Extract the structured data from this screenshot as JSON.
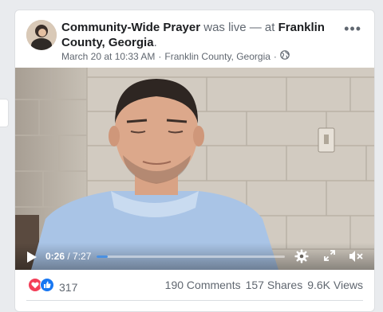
{
  "post": {
    "author": "Community-Wide Prayer",
    "action": " was live — at ",
    "location_bold": "Franklin County, Georgia",
    "trailing_dot": ".",
    "timestamp": "March 20 at 10:33 AM",
    "separator": " · ",
    "location": "Franklin County, Georgia",
    "separator2": " ·",
    "audience_icon": "globe-icon",
    "more_icon": "more-options-icon"
  },
  "video": {
    "current_time": "0:26",
    "total_time": " / 7:27",
    "progress": 0.058,
    "icons": [
      "play-icon",
      "settings-gear-icon",
      "fullscreen-icon",
      "muted-volume-icon"
    ]
  },
  "engagement": {
    "reaction_icons": [
      "love-reaction-icon",
      "like-reaction-icon"
    ],
    "reaction_count": "317",
    "comments": "190 Comments",
    "shares": "157 Shares",
    "views": "9.6K Views"
  },
  "colors": {
    "accent": "#4a90e2",
    "like_blue": "#1877f2",
    "love_red": "#f33e58",
    "meta_gray": "#606770"
  }
}
